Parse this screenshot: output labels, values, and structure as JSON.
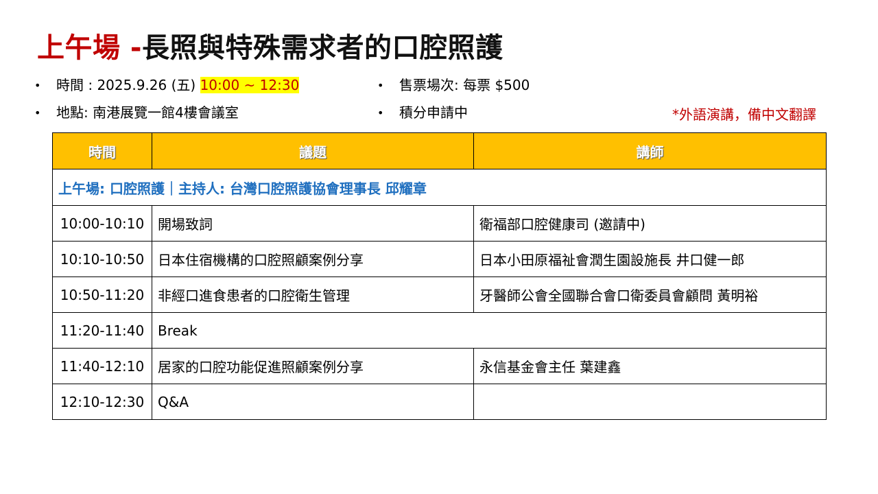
{
  "header": {
    "title_highlight": "上午場 -",
    "title_rest": "長照與特殊需求者的口腔照護"
  },
  "info": {
    "time_label": "時間 : 2025.9.26 (五) ",
    "time_highlight": "10:00 ~ 12:30",
    "location": "地點: 南港展覽一館4樓會議室",
    "ticket": "售票場次: 每票 $500",
    "credits": "積分申請中",
    "note": "*外語演講，備中文翻譯",
    "bullet": "•"
  },
  "table": {
    "headers": [
      "時間",
      "議題",
      "講師"
    ],
    "section": "上午場: 口腔照護｜主持人: 台灣口腔照護協會理事長 邱耀章",
    "rows": [
      {
        "time": "10:00-10:10",
        "topic": "開場致詞",
        "speaker": "衛福部口腔健康司 (邀請中)"
      },
      {
        "time": "10:10-10:50",
        "topic": "日本住宿機構的口腔照顧案例分享",
        "speaker": "日本小田原福祉會潤生園設施長 井口健一郎"
      },
      {
        "time": "10:50-11:20",
        "topic": "非經口進食患者的口腔衛生管理",
        "speaker": "牙醫師公會全國聯合會口衛委員會顧問 黃明裕"
      },
      {
        "time": "11:20-11:40",
        "topic": "Break",
        "speaker": ""
      },
      {
        "time": "11:40-12:10",
        "topic": "居家的口腔功能促進照顧案例分享",
        "speaker": "永信基金會主任 葉建鑫"
      },
      {
        "time": "12:10-12:30",
        "topic": "Q&A",
        "speaker": ""
      }
    ]
  }
}
